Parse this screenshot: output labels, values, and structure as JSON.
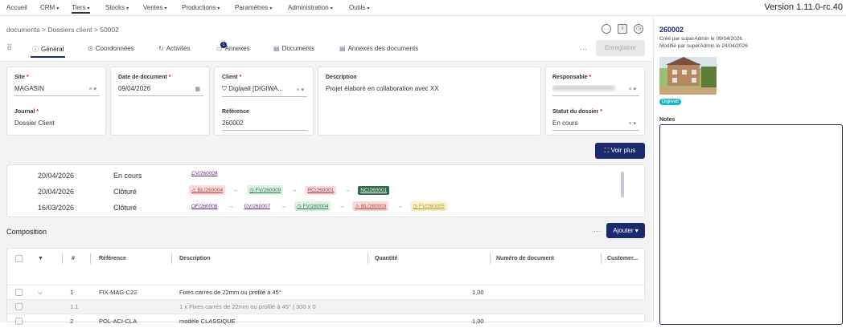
{
  "nav": {
    "items": [
      {
        "label": "Accueil",
        "dropdown": false
      },
      {
        "label": "CRM",
        "dropdown": true
      },
      {
        "label": "Tiers",
        "dropdown": true
      },
      {
        "label": "Stocks",
        "dropdown": true
      },
      {
        "label": "Ventes",
        "dropdown": true
      },
      {
        "label": "Productions",
        "dropdown": true
      },
      {
        "label": "Paramètres",
        "dropdown": true
      },
      {
        "label": "Administration",
        "dropdown": true
      },
      {
        "label": "Outils",
        "dropdown": true
      }
    ],
    "active": "Tiers",
    "version": "Version 1.11.0-rc.40"
  },
  "breadcrumb": "documents > Dossiers client > 50002",
  "tabs": [
    {
      "label": "Général",
      "icon": "info-circle-icon"
    },
    {
      "label": "Coordonnées",
      "icon": "location-pin-icon"
    },
    {
      "label": "Activités",
      "icon": "activity-icon"
    },
    {
      "label": "Annexes",
      "icon": "attachment-icon",
      "badge": "1"
    },
    {
      "label": "Documents",
      "icon": "document-icon"
    },
    {
      "label": "Annexes des documents",
      "icon": "document-icon"
    }
  ],
  "actions": {
    "more": "···",
    "save": "Enregistrer",
    "voir_plus": "Voir plus",
    "ajouter": "Ajouter"
  },
  "fields": {
    "site": {
      "label": "Site",
      "value": "MAGASIN"
    },
    "date": {
      "label": "Date de document",
      "value": "09/04/2026"
    },
    "client": {
      "label": "Client",
      "value": "Digiwall [DIGIWA..."
    },
    "description": {
      "label": "Description",
      "value": "Projet élaboré en collaboration avec XX"
    },
    "responsable": {
      "label": "Responsable"
    },
    "journal": {
      "label": "Journal",
      "value": "Dossier Client"
    },
    "reference": {
      "label": "Référence",
      "value": "260002"
    },
    "statut": {
      "label": "Statut du dossier",
      "value": "En cours"
    }
  },
  "timeline": [
    {
      "date": "20/04/2026",
      "status": "En cours",
      "chips": [
        {
          "text": "CV/260009",
          "style": "plain"
        }
      ]
    },
    {
      "date": "20/04/2026",
      "status": "Clôturé",
      "chips": [
        {
          "text": "⚠ BL/260004",
          "style": "red"
        },
        {
          "text": "◷ FV/260009",
          "style": "green"
        },
        {
          "text": "RC/260001",
          "style": "pink"
        },
        {
          "text": "NC/260001",
          "style": "dkgreen"
        }
      ]
    },
    {
      "date": "16/03/2026",
      "status": "Clôturé",
      "chips": [
        {
          "text": "OF/260008",
          "style": "plain"
        },
        {
          "text": "CV/260007",
          "style": "plain"
        },
        {
          "text": "◷ FV/260004",
          "style": "green"
        },
        {
          "text": "⚠ BL/260003",
          "style": "red"
        },
        {
          "text": "◷ FV/260005",
          "style": "yellow"
        }
      ]
    }
  ],
  "composition": {
    "title": "Composition",
    "columns": [
      "#",
      "Référence",
      "Description",
      "Quantité",
      "Numéro de document",
      "Customer..."
    ],
    "rows": [
      {
        "num": "1",
        "ref": "FIX-MAG-C22",
        "desc": "Fixes carrés de 22mm ou profilé à 45°",
        "qty": "1,00",
        "sub": false,
        "expand": true
      },
      {
        "num": "1.1",
        "ref": "",
        "desc": "1 x Fixes carrés de 22mm ou profilé à 45° | 300 x 0",
        "qty": "",
        "sub": true,
        "expand": false
      },
      {
        "num": "2",
        "ref": "POL-ACI-CLA",
        "desc": "modèle CLASSIQUE",
        "qty": "1,00",
        "sub": false,
        "expand": false
      }
    ]
  },
  "side": {
    "title": "260002",
    "created": "Créé par superAdmin le 09/04/2026",
    "modified": "Modifié par superAdmin le 24/04/2026",
    "tag": "Digiwall",
    "notes_label": "Notes"
  },
  "colors": {
    "primary": "#1a2a6c",
    "tag": "#17b7c7",
    "required": "#dd1144"
  }
}
